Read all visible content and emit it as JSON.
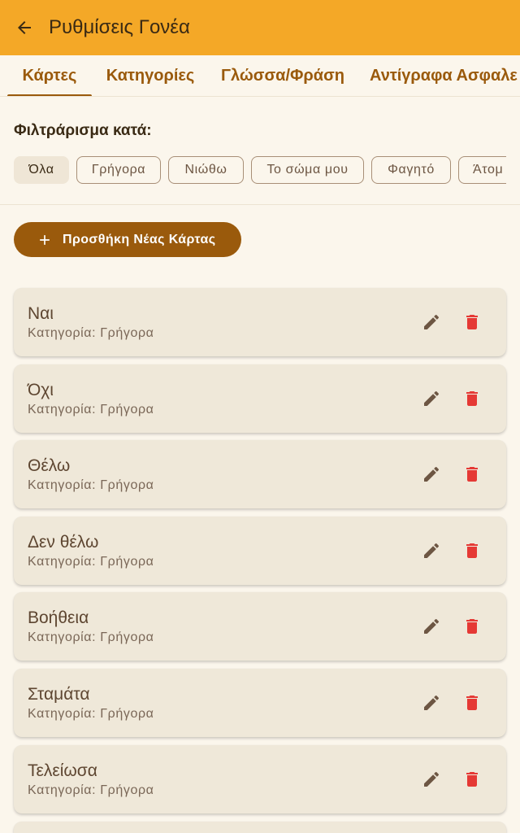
{
  "appbar": {
    "title": "Ρυθμίσεις Γονέα",
    "back_icon": "arrow-left-icon"
  },
  "tabs": [
    {
      "label": "Κάρτες",
      "active": true
    },
    {
      "label": "Κατηγορίες",
      "active": false
    },
    {
      "label": "Γλώσσα/Φράση",
      "active": false
    },
    {
      "label": "Αντίγραφα Ασφαλε",
      "active": false
    }
  ],
  "filter": {
    "label": "Φιλτράρισμα κατά:",
    "chips": [
      {
        "label": "Όλα",
        "selected": true
      },
      {
        "label": "Γρήγορα",
        "selected": false
      },
      {
        "label": "Νιώθω",
        "selected": false
      },
      {
        "label": "Το σώμα μου",
        "selected": false
      },
      {
        "label": "Φαγητό",
        "selected": false
      },
      {
        "label": "Άτομ",
        "selected": false
      }
    ]
  },
  "add_button": {
    "label": "Προσθήκη Νέας Κάρτας",
    "icon": "plus-icon"
  },
  "cards": [
    {
      "title": "Ναι",
      "category": "Κατηγορία: Γρήγορα"
    },
    {
      "title": "Όχι",
      "category": "Κατηγορία: Γρήγορα"
    },
    {
      "title": "Θέλω",
      "category": "Κατηγορία: Γρήγορα"
    },
    {
      "title": "Δεν θέλω",
      "category": "Κατηγορία: Γρήγορα"
    },
    {
      "title": "Βοήθεια",
      "category": "Κατηγορία: Γρήγορα"
    },
    {
      "title": "Σταμάτα",
      "category": "Κατηγορία: Γρήγορα"
    },
    {
      "title": "Τελείωσα",
      "category": "Κατηγορία: Γρήγορα"
    }
  ],
  "icons": {
    "edit": "pencil-icon",
    "delete": "trash-icon"
  },
  "colors": {
    "appbar": "#f4a827",
    "accent": "#9a5a0c",
    "background": "#fbf6ec",
    "card": "#efe8d9",
    "delete": "#e53935",
    "edit": "#6d5643"
  }
}
